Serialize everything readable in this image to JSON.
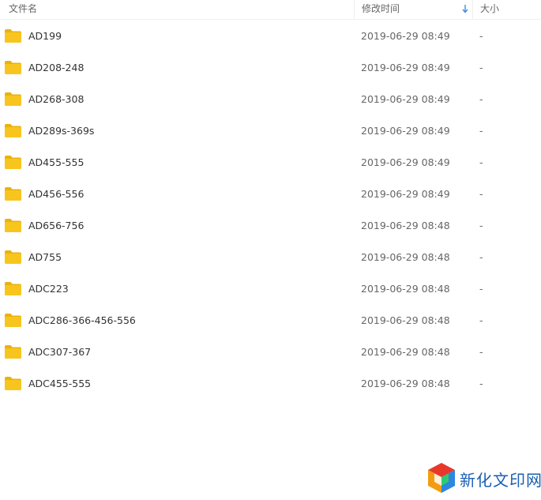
{
  "header": {
    "name_label": "文件名",
    "date_label": "修改时间",
    "size_label": "大小",
    "sort_icon": "arrow-down-icon"
  },
  "files": [
    {
      "name": "AD199",
      "date": "2019-06-29 08:49",
      "size": "-"
    },
    {
      "name": "AD208-248",
      "date": "2019-06-29 08:49",
      "size": "-"
    },
    {
      "name": "AD268-308",
      "date": "2019-06-29 08:49",
      "size": "-"
    },
    {
      "name": "AD289s-369s",
      "date": "2019-06-29 08:49",
      "size": "-"
    },
    {
      "name": "AD455-555",
      "date": "2019-06-29 08:49",
      "size": "-"
    },
    {
      "name": "AD456-556",
      "date": "2019-06-29 08:49",
      "size": "-"
    },
    {
      "name": "AD656-756",
      "date": "2019-06-29 08:48",
      "size": "-"
    },
    {
      "name": "AD755",
      "date": "2019-06-29 08:48",
      "size": "-"
    },
    {
      "name": "ADC223",
      "date": "2019-06-29 08:48",
      "size": "-"
    },
    {
      "name": "ADC286-366-456-556",
      "date": "2019-06-29 08:48",
      "size": "-"
    },
    {
      "name": "ADC307-367",
      "date": "2019-06-29 08:48",
      "size": "-"
    },
    {
      "name": "ADC455-555",
      "date": "2019-06-29 08:48",
      "size": "-"
    }
  ],
  "watermark": {
    "brand": "新化文印网",
    "icon": "cube-logo-icon"
  },
  "colors": {
    "folder": "#f7c51e",
    "folder_dark": "#e8b30d",
    "sort_arrow": "#3a8ee6",
    "brand_text": "#1a5fb4"
  }
}
